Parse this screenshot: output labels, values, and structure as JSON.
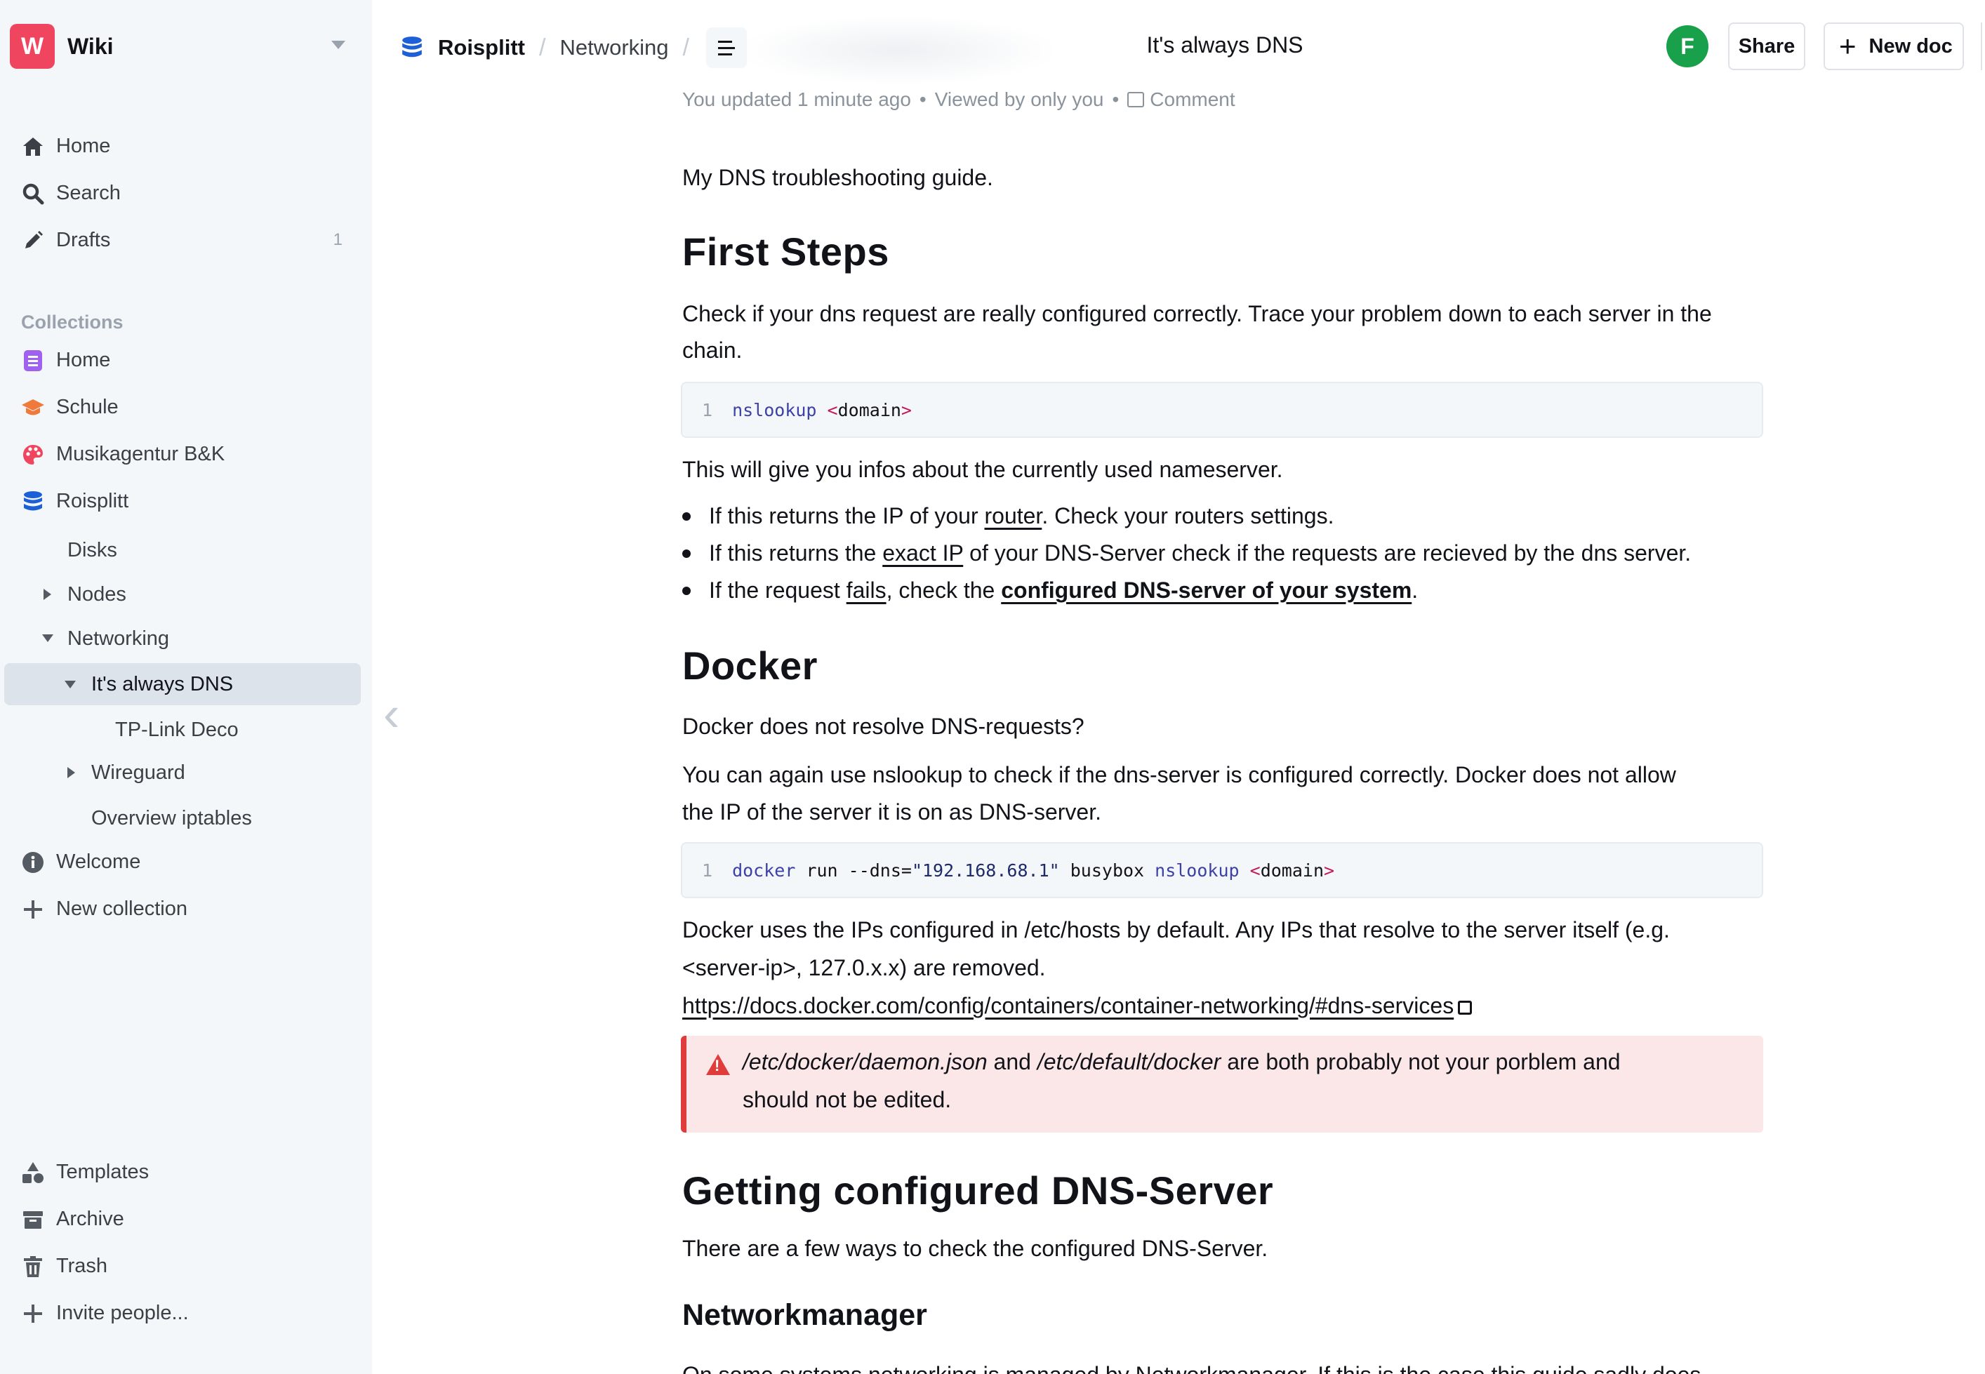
{
  "sidebar": {
    "team": {
      "logo_letter": "W",
      "name": "Wiki"
    },
    "nav": [
      {
        "label": "Home"
      },
      {
        "label": "Search"
      },
      {
        "label": "Drafts",
        "badge": "1"
      }
    ],
    "collections_label": "Collections",
    "collections": [
      {
        "label": "Home"
      },
      {
        "label": "Schule"
      },
      {
        "label": "Musikagentur B&K"
      },
      {
        "label": "Roisplitt"
      }
    ],
    "tree": [
      {
        "label": "Disks"
      },
      {
        "label": "Nodes"
      },
      {
        "label": "Networking"
      },
      {
        "label": "It's always DNS"
      },
      {
        "label": "TP-Link Deco"
      },
      {
        "label": "Wireguard"
      },
      {
        "label": "Overview iptables"
      }
    ],
    "welcome": "Welcome",
    "new_collection": "New collection",
    "footer": [
      {
        "label": "Templates"
      },
      {
        "label": "Archive"
      },
      {
        "label": "Trash"
      },
      {
        "label": "Invite people..."
      }
    ]
  },
  "header": {
    "breadcrumb": [
      "Roisplitt",
      "Networking"
    ],
    "separator": "/",
    "title": "It's always DNS",
    "avatar_letter": "F",
    "share_label": "Share",
    "new_doc_label": "New doc"
  },
  "doc": {
    "meta": {
      "updated": "You updated 1 minute ago",
      "viewed": "Viewed by only you",
      "comment": "Comment",
      "dot": "•"
    },
    "intro": "My DNS troubleshooting guide.",
    "h_first_steps": "First Steps",
    "p_check_1": "Check if your dns request are really configured correctly. Trace your problem down to each server in the",
    "p_check_2": "chain.",
    "code1": {
      "line": "1",
      "cmd": "nslookup",
      "arg": "domain"
    },
    "p_nameserver": "This will give you infos about the currently used nameserver.",
    "bullets": {
      "b1_pre": "If this returns the IP of your ",
      "b1_link": "router",
      "b1_post": ". Check your routers settings.",
      "b2_pre": "If this returns the ",
      "b2_link": "exact IP",
      "b2_post": " of your DNS-Server check if the requests are recieved by the dns server.",
      "b3_pre": "If the request ",
      "b3_link1": "fails",
      "b3_mid": ", check the ",
      "b3_link2": "configured DNS-server of your system",
      "b3_post": "."
    },
    "h_docker": "Docker",
    "p_docker_resolve": "Docker does not resolve DNS-requests?",
    "p_docker_again_1": "You can again use nslookup to check if the dns-server is configured correctly. Docker does not allow",
    "p_docker_again_2": "the IP of the server it is on as DNS-server.",
    "code2": {
      "line": "1",
      "cmd": "docker",
      "run": "run --dns=",
      "ip": "\"192.168.68.1\"",
      "image": "busybox",
      "cmd2": "nslookup",
      "arg": "domain"
    },
    "p_hosts_1": "Docker uses the IPs configured in /etc/hosts by default. Any IPs that resolve to the server itself (e.g.",
    "p_hosts_2": "<server-ip>, 127.0.x.x) are removed.",
    "docker_link": "https://docs.docker.com/config/containers/container-networking/#dns-services",
    "notice": {
      "path1": "/etc/docker/daemon.json",
      "and": " and ",
      "path2": "/etc/default/docker",
      "rest": " are both probably not your porblem and",
      "line2": "should not be edited."
    },
    "h_getting": "Getting configured DNS-Server",
    "p_few_ways": "There are a few ways to check the configured DNS-Server.",
    "h_networkmanager": "Networkmanager",
    "p_networkmanager": "On some systems networking is managed by Networkmanager. If this is the case this guide sadly does"
  },
  "colors": {
    "team_logo": "#f0455e",
    "avatar": "#19a04a",
    "sidebar_bg": "#f4f7fa",
    "active_item_bg": "#dde3ea",
    "notice_bg": "#fbe7e8",
    "notice_border": "#e03c3c"
  },
  "icons": {
    "home": "home-icon",
    "search": "search-icon",
    "drafts": "pencil-icon",
    "collection_home": "clipboard-icon",
    "schule": "graduation-cap-icon",
    "musikagentur": "palette-icon",
    "roisplitt": "database-icon",
    "welcome": "info-icon",
    "templates": "shapes-icon",
    "archive": "archive-icon",
    "trash": "trash-icon",
    "invite": "plus-icon"
  }
}
